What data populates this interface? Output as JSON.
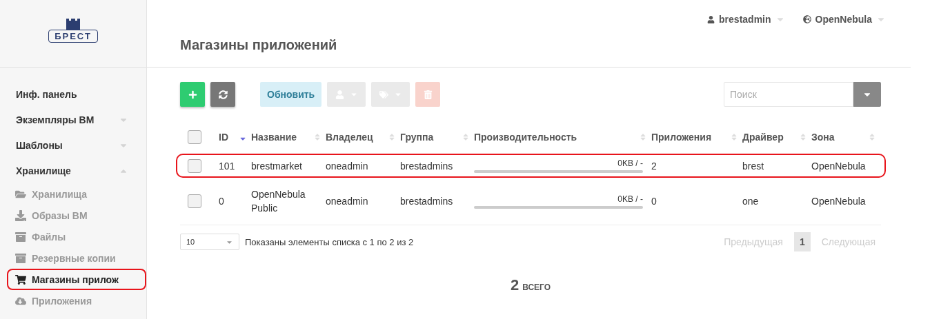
{
  "logo": {
    "text": "БРЕСТ"
  },
  "header": {
    "title": "Магазины приложений",
    "user": "brestadmin",
    "zone": "OpenNebula"
  },
  "sidebar": {
    "items": [
      {
        "label": "Инф. панель"
      },
      {
        "label": "Экземпляры ВМ",
        "expanded": false
      },
      {
        "label": "Шаблоны",
        "expanded": false
      },
      {
        "label": "Хранилище",
        "expanded": true,
        "children": [
          {
            "label": "Хранилища",
            "selected": false,
            "highlighted": false
          },
          {
            "label": "Образы ВМ",
            "selected": false,
            "highlighted": false
          },
          {
            "label": "Файлы",
            "selected": false,
            "highlighted": false
          },
          {
            "label": "Резервные копии",
            "selected": false,
            "highlighted": false
          },
          {
            "label": "Магазины прилож",
            "selected": true,
            "highlighted": true
          },
          {
            "label": "Приложения",
            "selected": false,
            "highlighted": false
          }
        ]
      }
    ]
  },
  "toolbar": {
    "buttons": [
      {
        "kind": "create",
        "disabled": false
      },
      {
        "kind": "refresh",
        "disabled": false
      },
      {
        "kind": "update",
        "label": "Обновить",
        "disabled": true
      },
      {
        "kind": "owner",
        "disabled": true
      },
      {
        "kind": "labels",
        "disabled": true
      },
      {
        "kind": "delete",
        "disabled": true
      }
    ],
    "search": {
      "placeholder": "Поиск"
    }
  },
  "table": {
    "select_all": {
      "checked": false
    },
    "columns": [
      {
        "label": "ID",
        "sorted": true
      },
      {
        "label": "Название",
        "sorted": false
      },
      {
        "label": "Владелец",
        "sorted": false
      },
      {
        "label": "Группа",
        "sorted": false
      },
      {
        "label": "Производительность",
        "sorted": false
      },
      {
        "label": "Приложения",
        "sorted": false
      },
      {
        "label": "Драйвер",
        "sorted": false
      },
      {
        "label": "Зона",
        "sorted": false
      }
    ],
    "rows": [
      {
        "checked": false,
        "highlighted": true,
        "id": "101",
        "name": "brestmarket",
        "owner": "oneadmin",
        "group": "brestadmins",
        "capacity": "0KB / -",
        "level": 0,
        "apps": "2",
        "driver": "brest",
        "zone": "OpenNebula"
      },
      {
        "checked": false,
        "highlighted": false,
        "id": "0",
        "name": "OpenNebula Public",
        "owner": "oneadmin",
        "group": "brestadmins",
        "capacity": "0KB / -",
        "level": 0,
        "apps": "0",
        "driver": "one",
        "zone": "OpenNebula"
      }
    ]
  },
  "footer": {
    "page_size": "10",
    "info": "Показаны элементы списка с 1 по 2 из 2",
    "pages": [
      {
        "label": "Предыдущая",
        "disabled": true,
        "selected": false
      },
      {
        "label": "1",
        "disabled": false,
        "selected": true
      },
      {
        "label": "Следующая",
        "disabled": true,
        "selected": false
      }
    ]
  },
  "total": {
    "count": "2",
    "label": "ВСЕГО"
  }
}
